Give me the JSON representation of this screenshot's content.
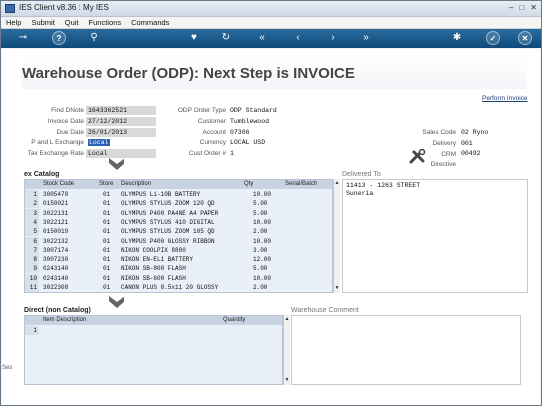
{
  "window": {
    "title": "IES Client v8.36 : My IES",
    "minimize": "–",
    "maximize": "□",
    "close": "✕"
  },
  "menu": [
    "Help",
    "Submit",
    "Quit",
    "Functions",
    "Commands"
  ],
  "toolbar": {
    "key_icon": "⊸",
    "help_icon": "?",
    "search_icon": "⚲",
    "heart_icon": "♥",
    "refresh_icon": "↻",
    "first_icon": "«",
    "prev_icon": "‹",
    "next_icon": "›",
    "last_icon": "»",
    "config_icon": "✱",
    "ok_icon": "✓",
    "cancel_icon": "✕"
  },
  "page": {
    "title": "Warehouse Order (ODP): Next Step is INVOICE",
    "perform_link": "Perform Invoice"
  },
  "header_left": [
    {
      "label": "Find DNote",
      "value": "1643362521"
    },
    {
      "label": "Invoice Date",
      "value": "27/12/2012"
    },
    {
      "label": "Due Date",
      "value": "26/01/2013"
    },
    {
      "label": "P and L Exchange",
      "value": "Local"
    },
    {
      "label": "Tax Exchange Rate",
      "value": "Local"
    }
  ],
  "header_mid": [
    {
      "label": "ODP Order Type",
      "value": "ODP Standard"
    },
    {
      "label": "Customer",
      "value": "Tumblewood"
    },
    {
      "label": "Account",
      "value": "07306"
    },
    {
      "label": "Currency",
      "value": "LOCAL USD"
    },
    {
      "label": "Cust Order #",
      "value": "1"
    }
  ],
  "header_right": [
    {
      "label": "Sales Code",
      "value": "02 Ryno"
    },
    {
      "label": "Delivery",
      "value": "001"
    },
    {
      "label": "CRM",
      "value": "00492"
    },
    {
      "label": "Directive",
      "value": ""
    }
  ],
  "catalog": {
    "title": "ex Catalog",
    "columns": [
      "Stock Code",
      "Store",
      "Description",
      "Qty",
      "Serial/Batch"
    ],
    "rows": [
      [
        "1",
        "3005478",
        "01",
        "OLYMPUS Li-10B BATTERY",
        "10.00"
      ],
      [
        "2",
        "0150021",
        "01",
        "OLYMPUS STYLUS ZOOM 120 QD",
        "5.00"
      ],
      [
        "3",
        "3022131",
        "01",
        "OLYMPUS P400 PA4NE A4 PAPER",
        "5.00"
      ],
      [
        "4",
        "3022121",
        "01",
        "OLYMPUS STYLUS 410 DIGITAL",
        "10.00"
      ],
      [
        "5",
        "0150019",
        "01",
        "OLYMPUS STYLUS ZOOM 105 QD",
        "2.00"
      ],
      [
        "6",
        "3022132",
        "01",
        "OLYMPUS P400 GLOSSY RIBBON",
        "10.00"
      ],
      [
        "7",
        "3007174",
        "01",
        "NIKON COOLPIX 8800",
        "3.00"
      ],
      [
        "8",
        "3007230",
        "01",
        "NIKON EN-EL1 BATTERY",
        "12.00"
      ],
      [
        "9",
        "0243140",
        "01",
        "NIKON SB-800 FLASH",
        "5.00"
      ],
      [
        "10",
        "0243140",
        "01",
        "NIKON SB-600 FLASH",
        "10.00"
      ],
      [
        "11",
        "3022308",
        "01",
        "CANON PLUS 8.5x11 20 GLOSSY",
        "2.00"
      ]
    ]
  },
  "delivered_to": {
    "title": "Delivered To",
    "lines": [
      "11413 - 1263 STREET",
      "Suneria"
    ]
  },
  "direct": {
    "title": "Direct (non Catalog)",
    "columns": [
      "Item Description",
      "Quantity"
    ],
    "rows": [
      [
        "1",
        "",
        ""
      ]
    ]
  },
  "warehouse_comment": {
    "title": "Warehouse Comment"
  },
  "side_label": "Ses"
}
